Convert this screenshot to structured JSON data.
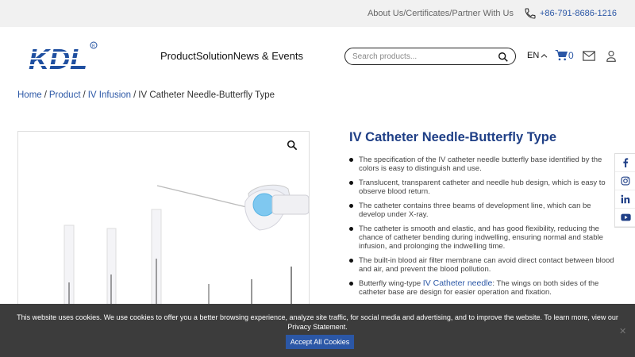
{
  "topbar": {
    "links": [
      "About Us",
      "Certificates",
      "Partner With Us"
    ],
    "separator": "/",
    "phone": "+86-791-8686-1216"
  },
  "header": {
    "logo_text": "KDL",
    "nav": [
      "Product",
      "Solution",
      "News & Events"
    ],
    "search_placeholder": "Search products...",
    "lang": "EN",
    "cart_count": "0"
  },
  "breadcrumb": {
    "items": [
      "Home",
      "Product",
      "IV Infusion"
    ],
    "separator": "/",
    "current": "IV Catheter Needle-Butterfly Type"
  },
  "product": {
    "title": "IV Catheter Needle-Butterfly Type",
    "features": [
      "The specification of the IV catheter needle butterfly base identified by the colors is easy to distinguish and use.",
      "Translucent, transparent catheter and needle hub design, which is easy to observe blood return.",
      "The catheter contains three beams of development line, which can be develop under X-ray.",
      "The catheter is smooth and elastic, and has good flexibility, reducing the chance of catheter bending during indwelling, ensuring normal and stable infusion, and prolonging the indwelling time.",
      "The built-in blood air filter membrane can avoid direct contact between blood and air, and prevent the blood pollution."
    ],
    "last_feature": {
      "prefix": "Butterfly wing-type ",
      "link": "IV Catheter needle",
      "suffix": ": The wings on both sides of the catheter base are design for easier operation and fixation."
    }
  },
  "social": [
    "facebook-icon",
    "instagram-icon",
    "linkedin-icon",
    "youtube-icon"
  ],
  "cookie": {
    "text": "This website uses cookies. We use cookies to offer you a better browsing experience, analyze site traffic, for social media and advertising, and to improve the website. To learn more, view our Privacy Statement.",
    "button": "Accept All Cookies",
    "close": "✕"
  },
  "colors": {
    "accent": "#2b57a6",
    "title": "#1f3f86",
    "cookie_bg": "#3c3c3c"
  }
}
